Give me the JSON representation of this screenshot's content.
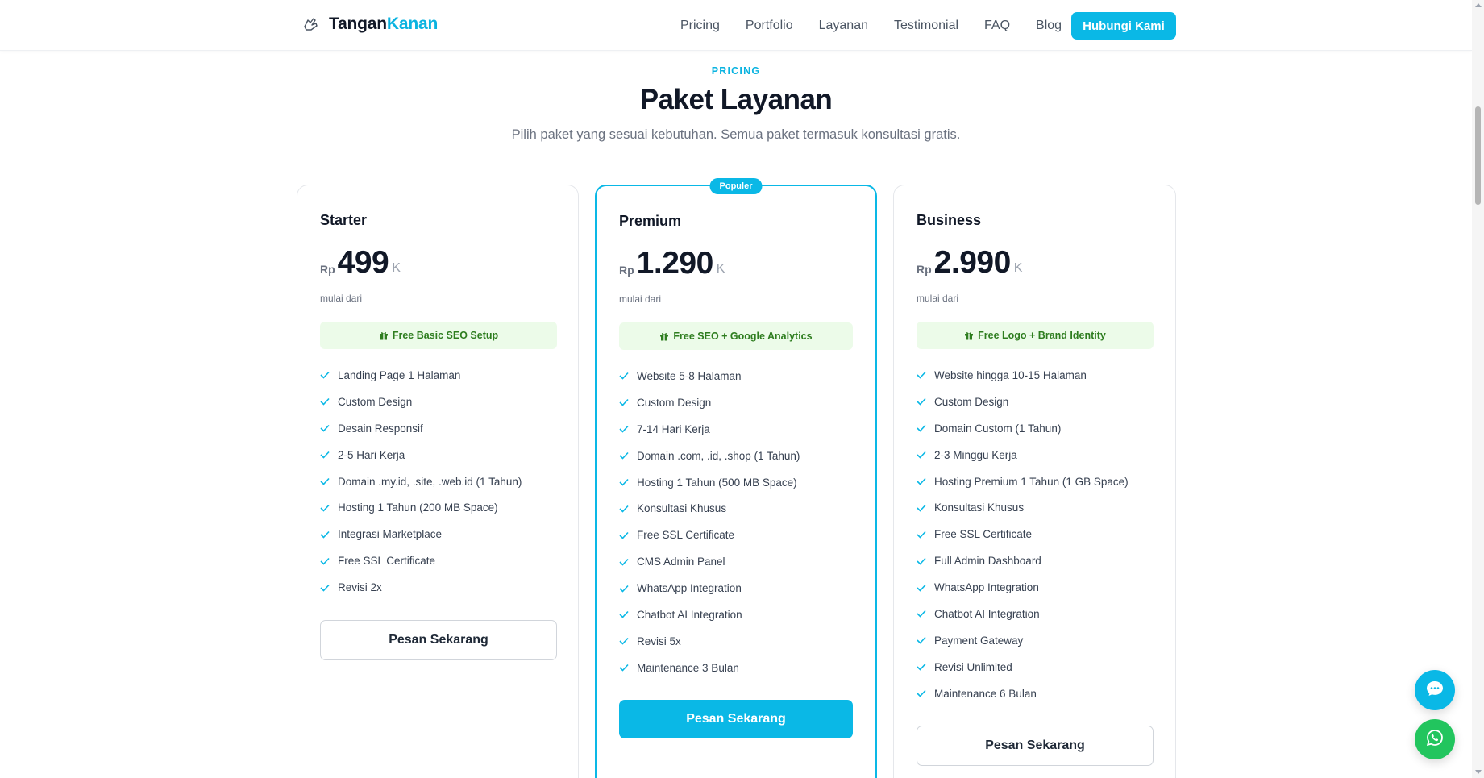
{
  "brand": {
    "part1": "Tangan",
    "part2": "Kanan"
  },
  "nav": {
    "items": [
      "Pricing",
      "Portfolio",
      "Layanan",
      "Testimonial",
      "FAQ",
      "Blog"
    ],
    "cta": "Hubungi Kami"
  },
  "section": {
    "eyebrow": "PRICING",
    "title": "Paket Layanan",
    "subtitle": "Pilih paket yang sesuai kebutuhan. Semua paket termasuk konsultasi gratis."
  },
  "plans": [
    {
      "name": "Starter",
      "currency": "Rp",
      "price": "499",
      "suffix": "K",
      "from": "mulai dari",
      "bonus": "Free Basic SEO Setup",
      "features": [
        "Landing Page 1 Halaman",
        "Custom Design",
        "Desain Responsif",
        "2-5 Hari Kerja",
        "Domain .my.id, .site, .web.id (1 Tahun)",
        "Hosting 1 Tahun (200 MB Space)",
        "Integrasi Marketplace",
        "Free SSL Certificate",
        "Revisi 2x"
      ],
      "cta": "Pesan Sekarang"
    },
    {
      "name": "Premium",
      "badge": "Populer",
      "currency": "Rp",
      "price": "1.290",
      "suffix": "K",
      "from": "mulai dari",
      "bonus": "Free SEO + Google Analytics",
      "features": [
        "Website 5-8 Halaman",
        "Custom Design",
        "7-14 Hari Kerja",
        "Domain .com, .id, .shop (1 Tahun)",
        "Hosting 1 Tahun (500 MB Space)",
        "Konsultasi Khusus",
        "Free SSL Certificate",
        "CMS Admin Panel",
        "WhatsApp Integration",
        "Chatbot AI Integration",
        "Revisi 5x",
        "Maintenance 3 Bulan"
      ],
      "cta": "Pesan Sekarang"
    },
    {
      "name": "Business",
      "currency": "Rp",
      "price": "2.990",
      "suffix": "K",
      "from": "mulai dari",
      "bonus": "Free Logo + Brand Identity",
      "features": [
        "Website hingga 10-15 Halaman",
        "Custom Design",
        "Domain Custom (1 Tahun)",
        "2-3 Minggu Kerja",
        "Hosting Premium 1 Tahun (1 GB Space)",
        "Konsultasi Khusus",
        "Free SSL Certificate",
        "Full Admin Dashboard",
        "WhatsApp Integration",
        "Chatbot AI Integration",
        "Payment Gateway",
        "Revisi Unlimited",
        "Maintenance 6 Bulan"
      ],
      "cta": "Pesan Sekarang"
    }
  ],
  "icons": {
    "logo": "hand-logo-icon",
    "check": "check-icon",
    "gift": "gift-icon",
    "chat": "chat-bubble-icon",
    "whatsapp": "whatsapp-icon"
  },
  "colors": {
    "accent": "#0ab8e6",
    "bonus_bg": "#ecfbe9",
    "bonus_text": "#2e7d1f",
    "whatsapp": "#22c55e"
  }
}
